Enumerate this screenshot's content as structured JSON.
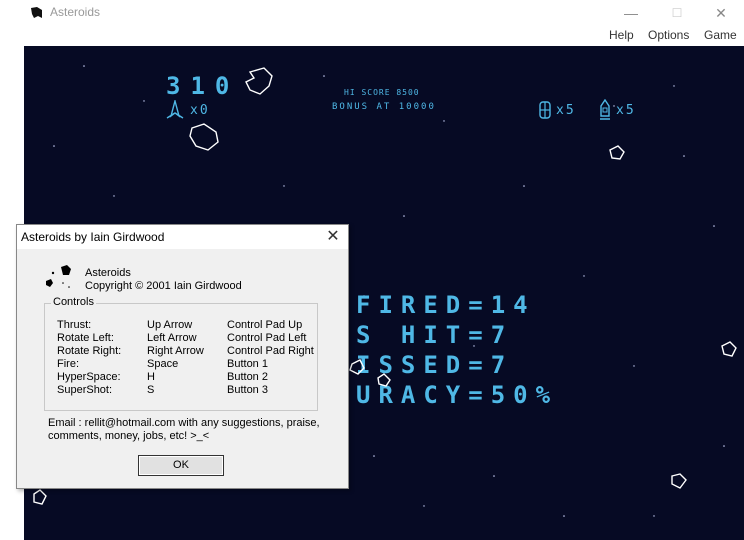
{
  "window": {
    "title": "Asteroids",
    "min_glyph": "—",
    "max_glyph": "☐",
    "close_glyph": "✕"
  },
  "menu": [
    "Help",
    "Options",
    "Game"
  ],
  "hud": {
    "score": "310",
    "ships_label": "x0",
    "hi_score": "HI SCORE 8500",
    "bonus": "BONUS AT 10000",
    "hyperspace_count": "x5",
    "shield_count": "x5"
  },
  "stats": [
    "FIRED=14",
    "S HIT=7",
    "ISSED=7",
    "URACY=50%"
  ],
  "dialog": {
    "title": "Asteroids by Iain Girdwood",
    "close_glyph": "✕",
    "app_name": "Asteroids",
    "copyright": "Copyright © 2001 Iain Girdwood",
    "controls_label": "Controls",
    "controls": [
      {
        "action": "Thrust:",
        "key": "Up Arrow",
        "pad": "Control Pad Up"
      },
      {
        "action": "Rotate Left:",
        "key": "Left Arrow",
        "pad": "Control Pad Left"
      },
      {
        "action": "Rotate Right:",
        "key": "Right Arrow",
        "pad": "Control Pad Right"
      },
      {
        "action": "Fire:",
        "key": "Space",
        "pad": "Button 1"
      },
      {
        "action": "HyperSpace:",
        "key": "H",
        "pad": "Button 2"
      },
      {
        "action": "SuperShot:",
        "key": "S",
        "pad": "Button 3"
      }
    ],
    "email_line1": "Email : rellit@hotmail.com with any suggestions, praise,",
    "email_line2": "comments, money, jobs,  etc!  >_<",
    "ok_label": "OK"
  },
  "colors": {
    "background": "#060a24",
    "hud": "#4fb8e6",
    "asteroid": "#ffffff"
  }
}
